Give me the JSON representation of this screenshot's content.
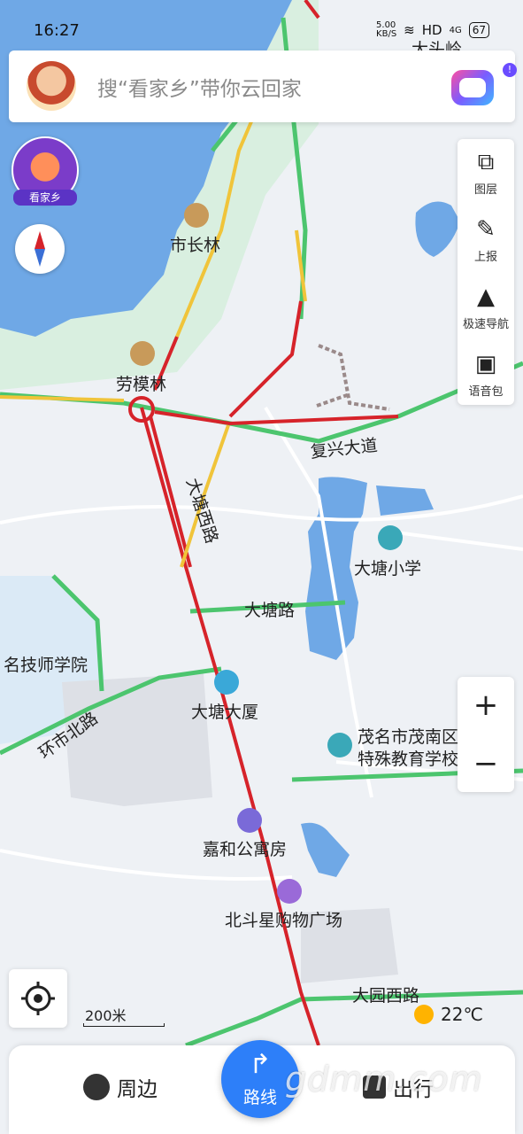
{
  "status_bar": {
    "time": "16:27",
    "network_speed": "5.00\nKB/S",
    "hd": "HD",
    "signal": "4G",
    "battery": "67"
  },
  "search": {
    "placeholder": "搜“看家乡”带你云回家"
  },
  "kanjiaxiang": {
    "label": "看家乡"
  },
  "toolbar": {
    "layers": "图层",
    "report": "上报",
    "fast_nav": "极速导航",
    "voice_pack": "语音包"
  },
  "zoom": {
    "in": "+",
    "out": "−"
  },
  "scale": {
    "label": "200米"
  },
  "weather": {
    "temp": "22℃"
  },
  "bottom": {
    "nearby": "周边",
    "route": "路线",
    "trip": "出行"
  },
  "watermark": "gdmm.com",
  "map": {
    "roads": {
      "fuxing": "复兴大道",
      "datang_west": "大塘西路",
      "datang": "大塘路",
      "huanshi_north": "环市北路",
      "dayuan_west": "大园西路"
    },
    "pois": {
      "shichanglin": "市长林",
      "laomolin": "劳模林",
      "datang_school": "大塘小学",
      "technician_college": "名技师学院",
      "datang_building": "大塘大厦",
      "special_school_1": "茂名市茂南区",
      "special_school_2": "特殊教育学校",
      "jiahe_apartment": "嘉和公寓房",
      "beidouxing_mall": "北斗星购物广场",
      "top_partial": "大头岭"
    }
  }
}
